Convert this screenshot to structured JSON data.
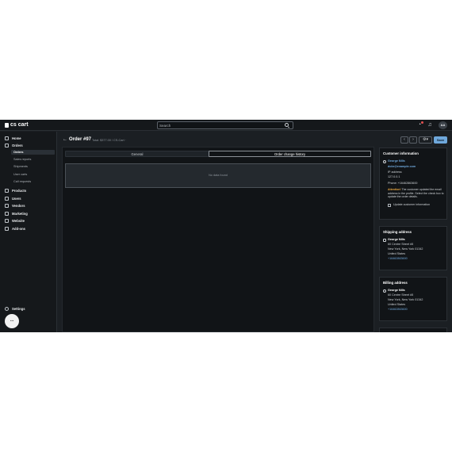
{
  "topbar": {
    "logo_text": "cs cart",
    "search_placeholder": "Search",
    "avatar_initials": "AA"
  },
  "sidebar": {
    "items": [
      {
        "label": "Home",
        "icon": "home-icon"
      },
      {
        "label": "Orders",
        "icon": "orders-icon"
      },
      {
        "label": "Products",
        "icon": "products-icon"
      },
      {
        "label": "Users",
        "icon": "users-icon"
      },
      {
        "label": "Vendors",
        "icon": "vendors-icon"
      },
      {
        "label": "Marketing",
        "icon": "marketing-icon"
      },
      {
        "label": "Website",
        "icon": "website-icon"
      },
      {
        "label": "Add-ons",
        "icon": "addons-icon"
      }
    ],
    "orders_sub": [
      "Orders",
      "Sales reports",
      "Shipments",
      "User carts",
      "Call requests"
    ],
    "settings_label": "Settings"
  },
  "header": {
    "title": "Order #97",
    "subtitle": "Total: $377.00 / CS-Cart ·",
    "save_label": "Save"
  },
  "tabs": {
    "general": "General",
    "history": "Order change history"
  },
  "main": {
    "no_data": "No data found"
  },
  "customer": {
    "title": "Customer information",
    "name": "George Nills",
    "email": "dobr@example.com",
    "ip_label": "IP address",
    "ip_value": "127.0.0.1",
    "phone": "Phone: +16462863600",
    "attention_label": "Attention!",
    "attention_text": "The customer updated the email address in the profile. Select the check box to update the order details.",
    "update_label": "Update customer information"
  },
  "shipping": {
    "title": "Shipping address",
    "name": "George Nills",
    "street": "60 Centre Street #5",
    "city": "New York, New York 01342",
    "country": "United States",
    "phone": "+16462863600"
  },
  "billing": {
    "title": "Billing address",
    "name": "George Nills",
    "street": "60 Centre Street #5",
    "city": "New York, New York 01342",
    "country": "United States",
    "phone": "+16462863600"
  }
}
